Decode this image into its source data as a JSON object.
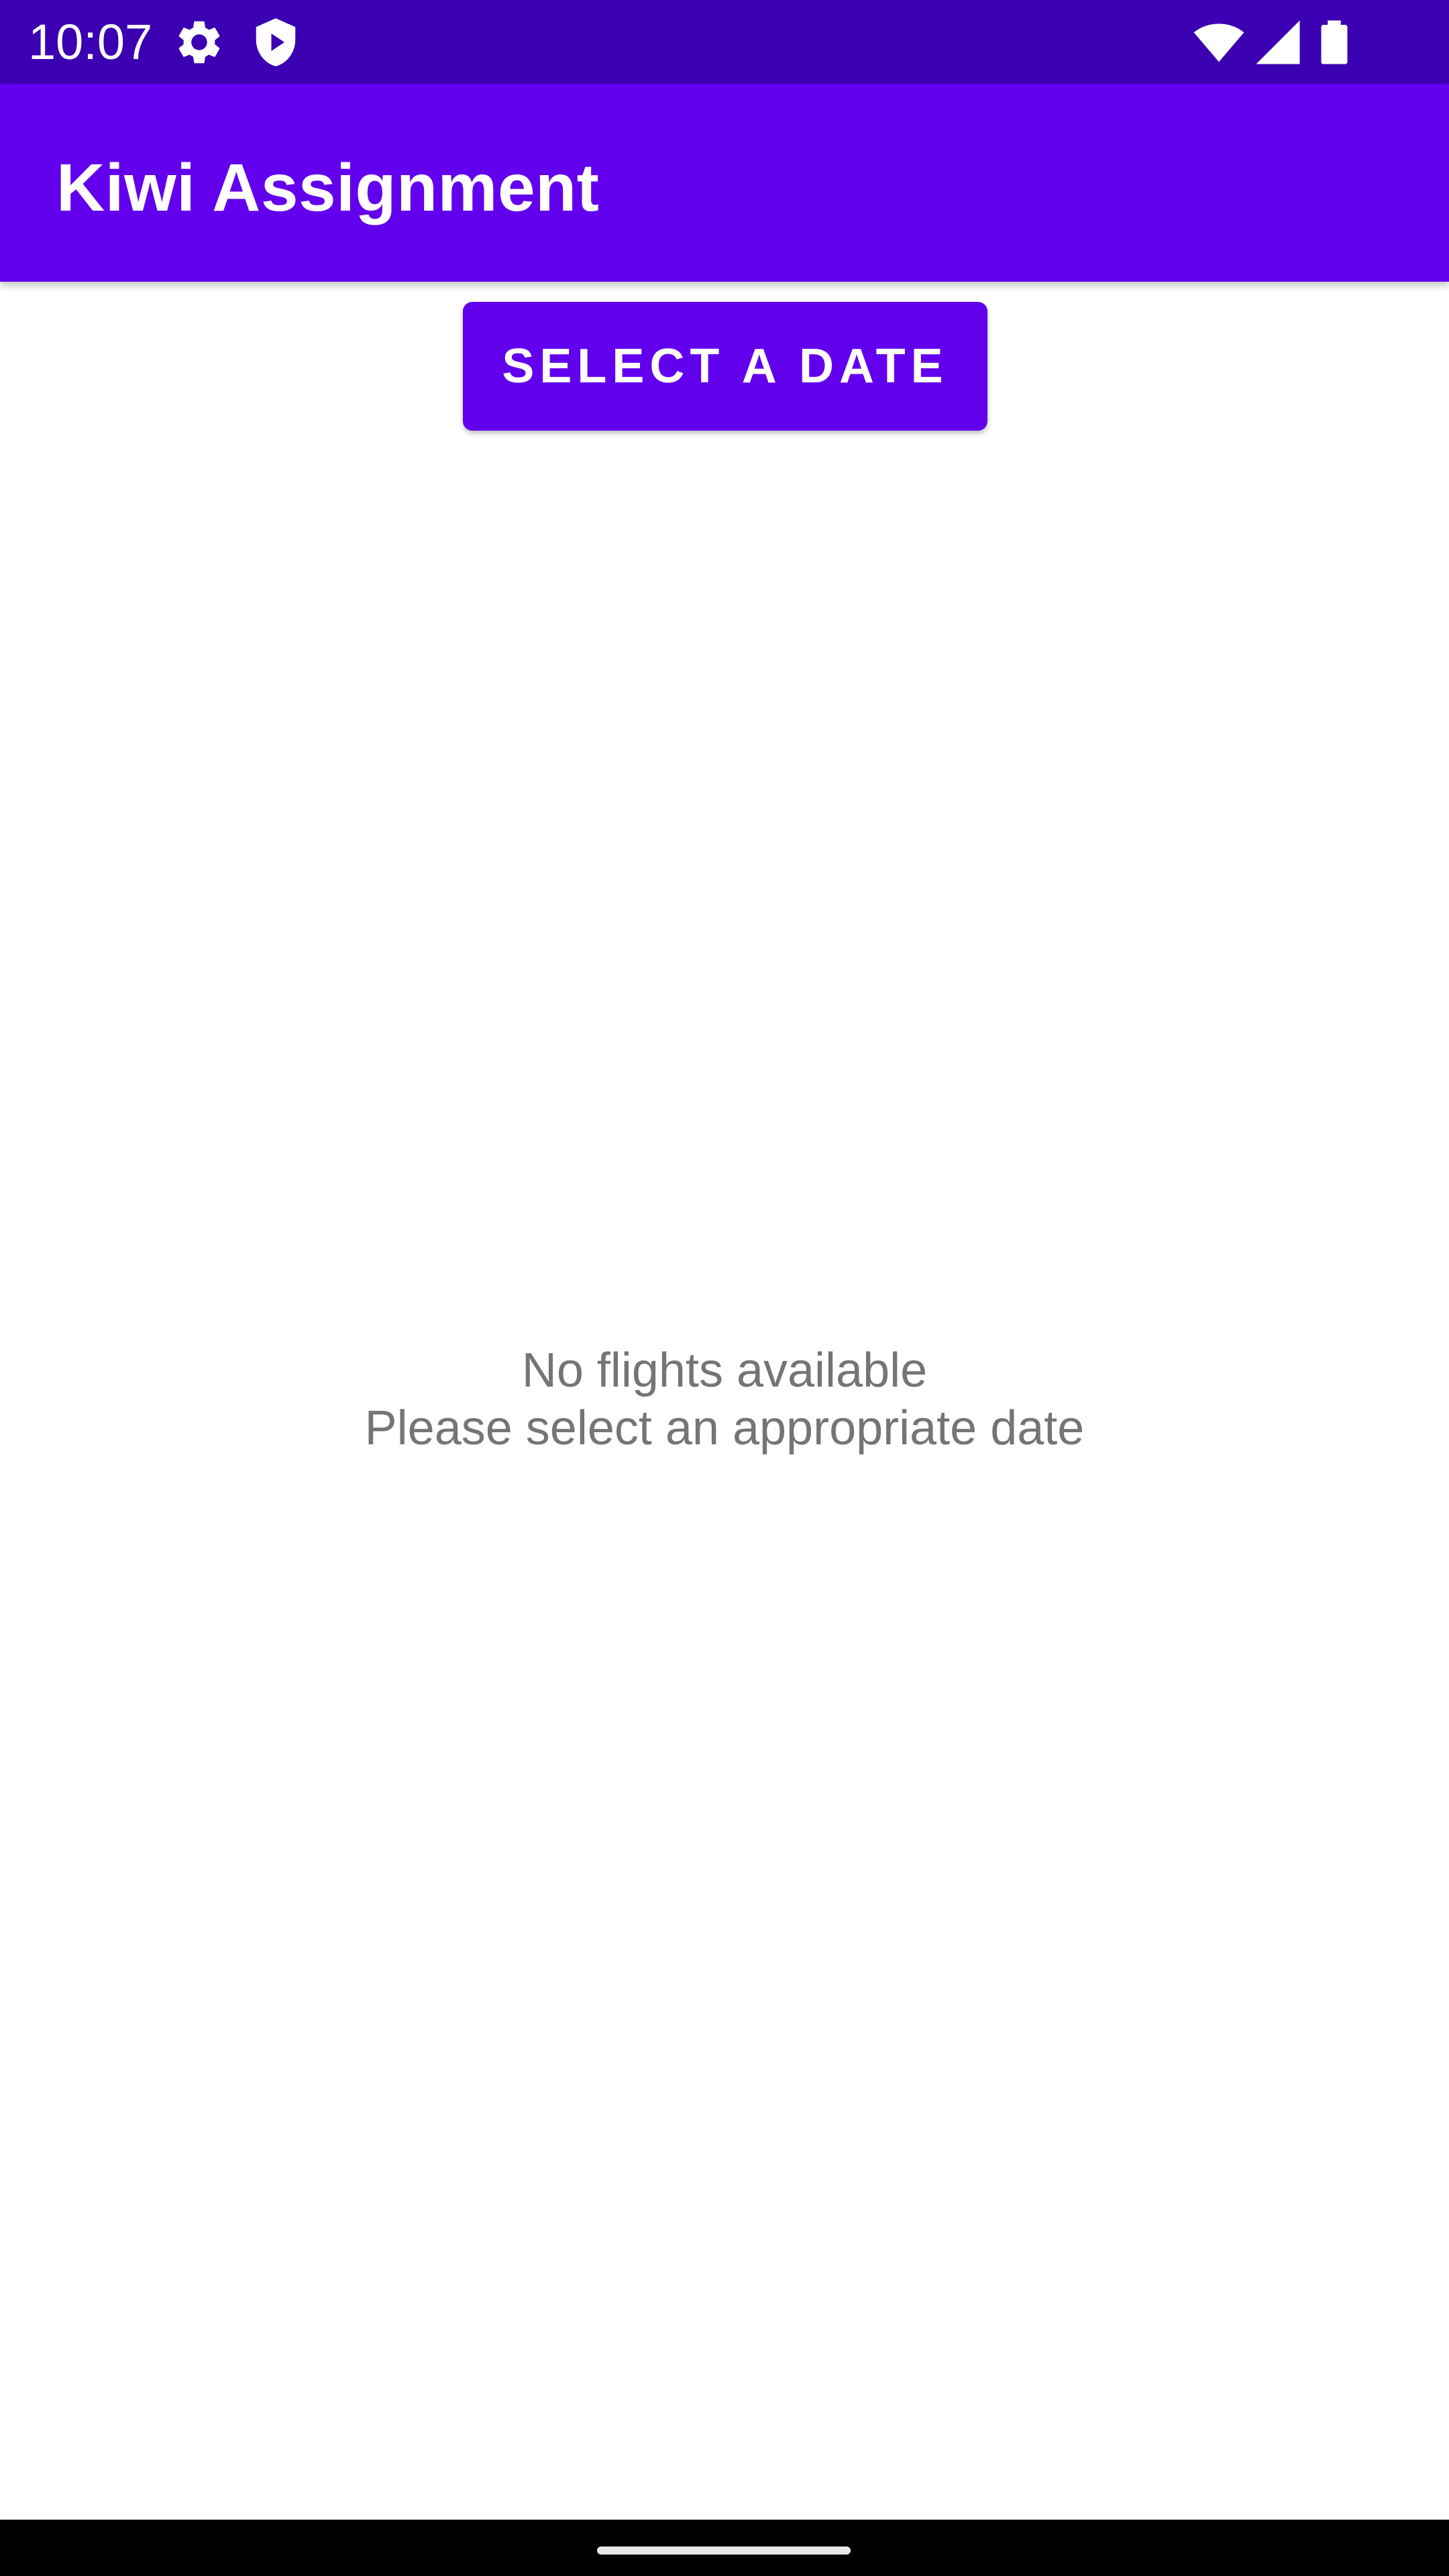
{
  "status_bar": {
    "time": "10:07",
    "icons": [
      "settings-gear-icon",
      "shield-play-icon",
      "wifi-icon",
      "cellular-signal-icon",
      "battery-icon"
    ],
    "background_color": "#3a00b2"
  },
  "app_bar": {
    "title": "Kiwi Assignment",
    "background_color": "#6200ee"
  },
  "main": {
    "select_date_button_label": "SELECT A DATE",
    "empty_state": {
      "line1": "No flights available",
      "line2": "Please select an appropriate date"
    }
  },
  "colors": {
    "accent": "#6200ee",
    "text_secondary": "#757575"
  }
}
